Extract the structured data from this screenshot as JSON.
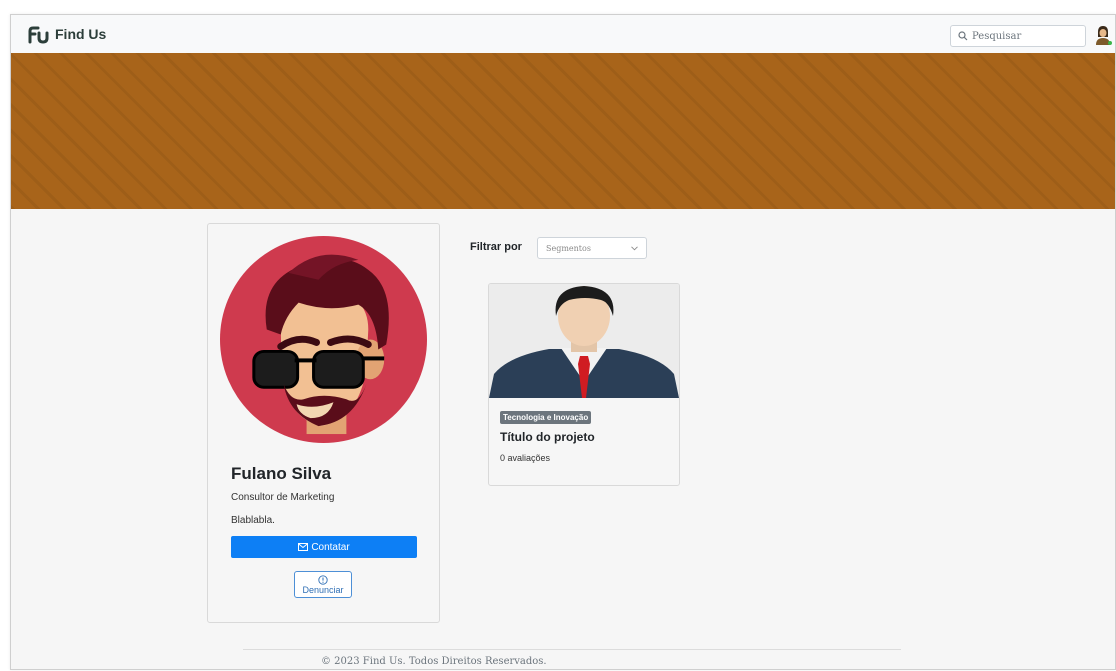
{
  "brand": {
    "name": "Find Us",
    "logo_icon": "fu-logo-icon"
  },
  "search": {
    "placeholder": "Pesquisar",
    "icon": "search-icon"
  },
  "user": {
    "avatar_icon": "user-avatar-icon"
  },
  "colors": {
    "banner": "#a8641a",
    "primary": "#0d7ff5",
    "badge": "#6c757d",
    "avatar_bg": "#cf3a4e"
  },
  "profile": {
    "name": "Fulano Silva",
    "role": "Consultor de Marketing",
    "bio": "Blablabla.",
    "contact_label": "Contatar",
    "contact_icon": "envelope-icon",
    "report_label": "Denunciar",
    "report_icon": "exclamation-circle-icon"
  },
  "filter": {
    "label": "Filtrar por",
    "selected": "Segmentos"
  },
  "projects": [
    {
      "tag": "Tecnologia e Inovação",
      "title": "Título do projeto",
      "rating": "0 avaliações"
    }
  ],
  "footer": {
    "text": "© 2023 Find Us. Todos Direitos Reservados."
  }
}
